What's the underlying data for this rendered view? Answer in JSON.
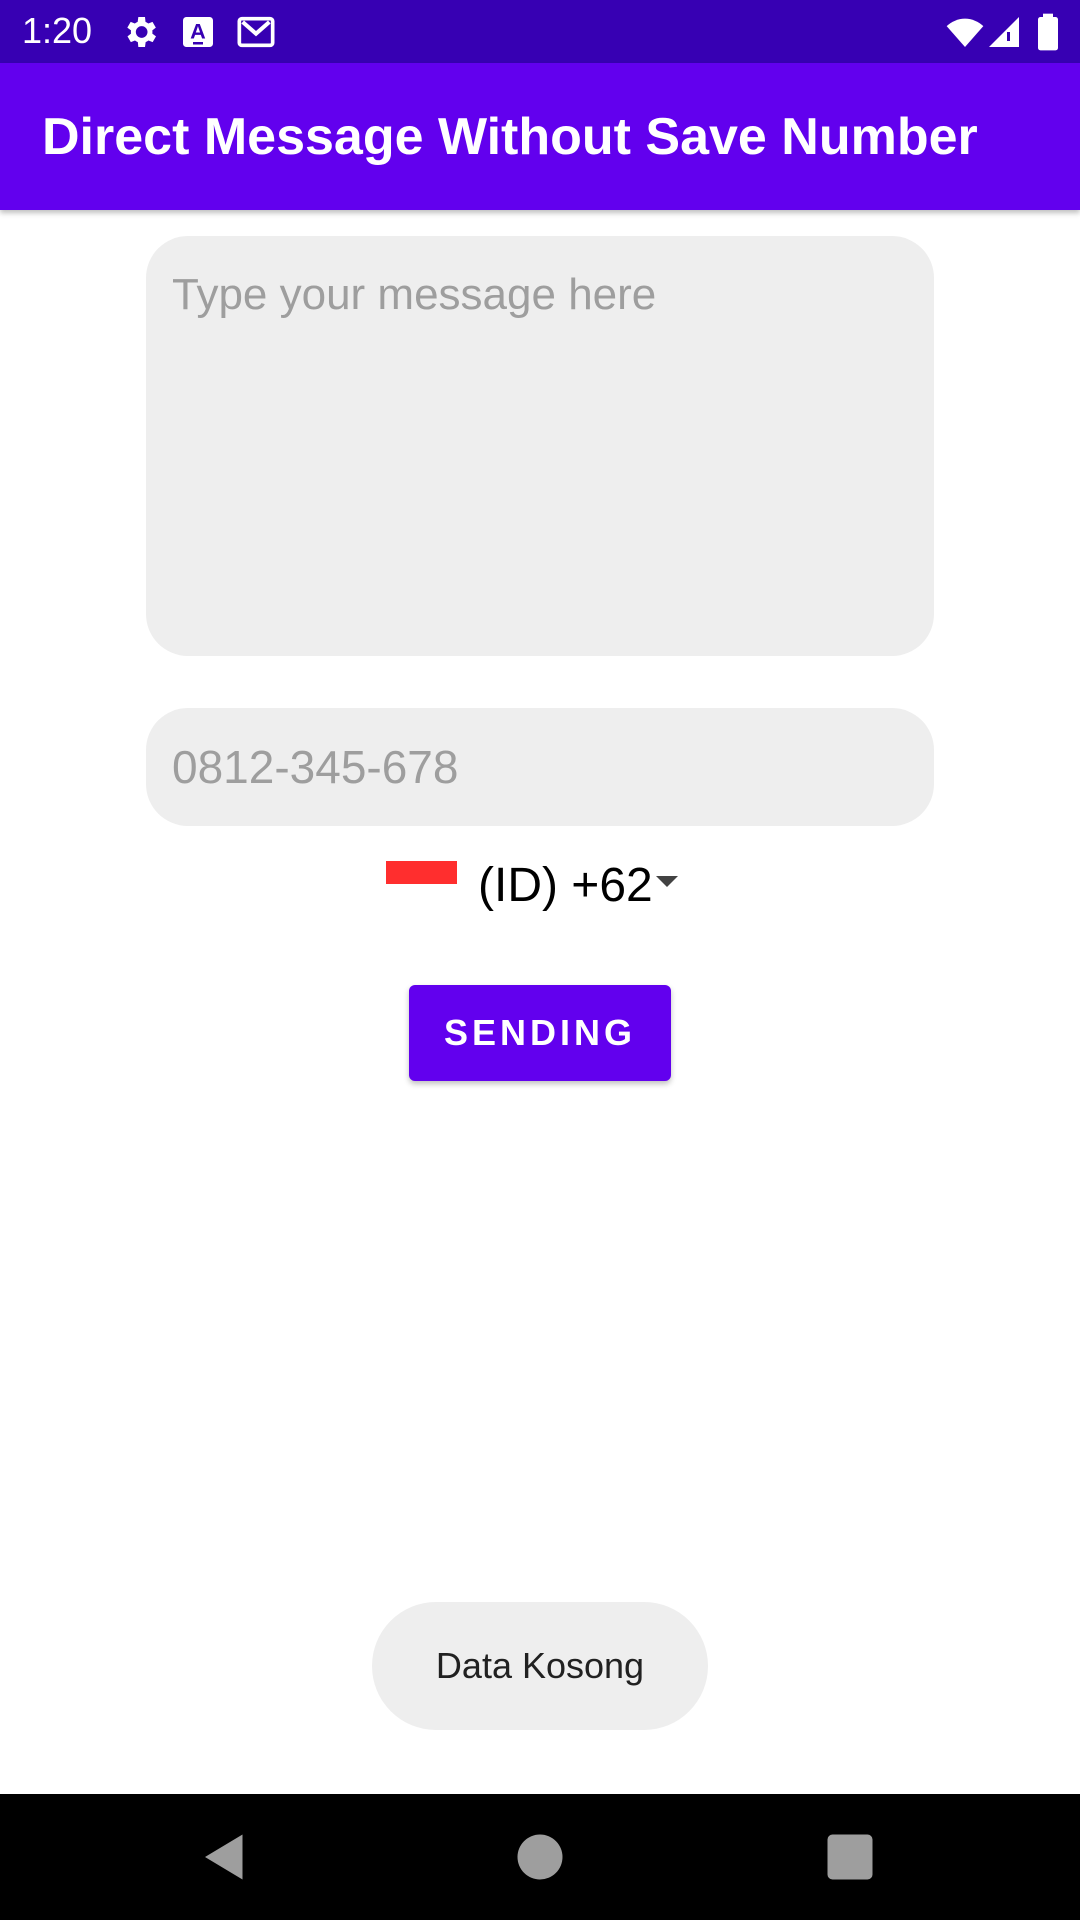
{
  "status_bar": {
    "time": "1:20",
    "icons": [
      "gear-icon",
      "text-recognition-icon",
      "gmail-icon",
      "wifi-icon",
      "signal-icon",
      "battery-icon"
    ]
  },
  "app_bar": {
    "title": "Direct Message Without Save Number",
    "color": "#6200ee"
  },
  "message_input": {
    "placeholder": "Type your message here",
    "value": ""
  },
  "phone_input": {
    "placeholder": "0812-345-678",
    "value": ""
  },
  "country_picker": {
    "flag": "indonesia-flag-icon",
    "selected": "(ID) +62"
  },
  "send_button": {
    "label": "SENDING"
  },
  "toast": {
    "text": "Data Kosong"
  },
  "nav_bar": {
    "icons": [
      "back-icon",
      "home-icon",
      "recents-icon"
    ]
  },
  "colors": {
    "status_bar": "#3700b3",
    "primary": "#6200ee",
    "input_bg": "#eeeeee",
    "placeholder": "#9e9e9e",
    "flag_red": "#ff2e2e"
  }
}
